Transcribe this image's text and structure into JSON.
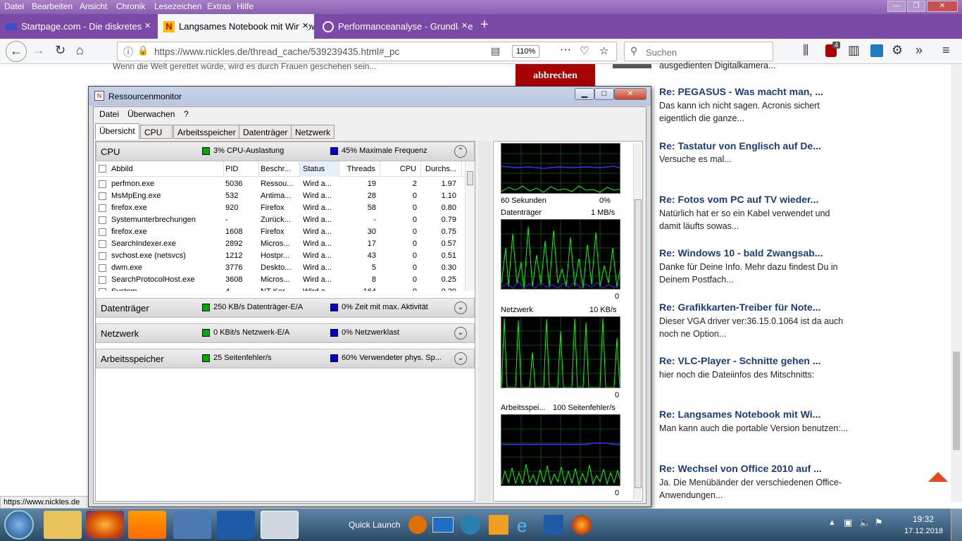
{
  "menu": [
    "Datei",
    "Bearbeiten",
    "Ansicht",
    "Chronik",
    "Lesezeichen",
    "Extras",
    "Hilfe"
  ],
  "window_controls": {
    "minimize": "—",
    "restore": "❐",
    "close": "✕"
  },
  "tabs": [
    {
      "title": "Startpage.com - Die diskreteste",
      "close": "×"
    },
    {
      "title": "Langsames Notebook mit Windows",
      "close": "×"
    },
    {
      "title": "Performanceanalyse - Grundlage",
      "close": "×"
    }
  ],
  "new_tab": "+",
  "nav": {
    "url": "https://www.nickles.de/thread_cache/539239435.html#_pc",
    "zoom": "110%",
    "search_placeholder": "Suchen",
    "badge": "4"
  },
  "page": {
    "top_text": "Wenn die Welt gerettet würde, wird es durch Frauen geschehen sein...",
    "cancel_button": "abbrechen",
    "top_right_text": "ausgedienten Digitalkamera...",
    "threads": [
      {
        "title": "Re: PEGASUS - Was macht man, ...",
        "text": "Das kann ich nicht sagen. Acronis sichert eigentlich die ganze..."
      },
      {
        "title": "Re: Tastatur von Englisch auf De...",
        "text": "Versuche es mal..."
      },
      {
        "title": "Re: Fotos vom PC auf TV wieder...",
        "text": "Natürlich hat er so ein Kabel verwendet und damit läufts sowas..."
      },
      {
        "title": "Re: Windows 10 - bald Zwangsab...",
        "text": "Danke für Deine Info. Mehr dazu findest Du in Deinem Postfach..."
      },
      {
        "title": "Re: Grafikkarten-Treiber für Note...",
        "text": "Dieser VGA driver ver:36.15.0.1064 ist da auch noch ne Option..."
      },
      {
        "title": "Re: VLC-Player - Schnitte gehen ...",
        "text": "hier noch die Dateiinfos des Mitschnitts:"
      },
      {
        "title": "Re: Langsames Notebook mit Wi...",
        "text": "Man kann auch die portable Version benutzen:..."
      },
      {
        "title": "Re: Wechsel von Office 2010 auf ...",
        "text": "Ja. Die Menübänder der verschiedenen Office-Anwendungen..."
      }
    ]
  },
  "status_url": "https://www.nickles.de",
  "resmon": {
    "title": "Ressourcenmonitor",
    "menu": [
      "Datei",
      "Überwachen",
      "?"
    ],
    "tabs": [
      "Übersicht",
      "CPU",
      "Arbeitsspeicher",
      "Datenträger",
      "Netzwerk"
    ],
    "cpu": {
      "label": "CPU",
      "stat1": "3% CPU-Auslastung",
      "stat2": "45% Maximale Frequenz",
      "columns": [
        "Abbild",
        "PID",
        "Beschr...",
        "Status",
        "Threads",
        "CPU",
        "Durchs..."
      ],
      "rows": [
        [
          "perfmon.exe",
          "5036",
          "Ressou...",
          "Wird a...",
          "19",
          "2",
          "1.97"
        ],
        [
          "MsMpEng.exe",
          "532",
          "Antima...",
          "Wird a...",
          "28",
          "0",
          "1.10"
        ],
        [
          "firefox.exe",
          "920",
          "Firefox",
          "Wird a...",
          "58",
          "0",
          "0.80"
        ],
        [
          "Systemunterbrechungen",
          "-",
          "Zurück...",
          "Wird a...",
          "-",
          "0",
          "0.79"
        ],
        [
          "firefox.exe",
          "1608",
          "Firefox",
          "Wird a...",
          "30",
          "0",
          "0.75"
        ],
        [
          "SearchIndexer.exe",
          "2892",
          "Micros...",
          "Wird a...",
          "17",
          "0",
          "0.57"
        ],
        [
          "svchost.exe (netsvcs)",
          "1212",
          "Hostpr...",
          "Wird a...",
          "43",
          "0",
          "0.51"
        ],
        [
          "dwm.exe",
          "3776",
          "Deskto...",
          "Wird a...",
          "5",
          "0",
          "0.30"
        ],
        [
          "SearchProtocolHost.exe",
          "3608",
          "Micros...",
          "Wird a...",
          "8",
          "0",
          "0.25"
        ],
        [
          "System",
          "4",
          "NT Ker...",
          "Wird a...",
          "164",
          "0",
          "0.20"
        ]
      ]
    },
    "disk": {
      "label": "Datenträger",
      "stat1": "250 KB/s Datenträger-E/A",
      "stat2": "0% Zeit mit max. Aktivität"
    },
    "network": {
      "label": "Netzwerk",
      "stat1": "0 KBit/s Netzwerk-E/A",
      "stat2": "0% Netzwerklast"
    },
    "memory": {
      "label": "Arbeitsspeicher",
      "stat1": "25 Seitenfehler/s",
      "stat2": "60% Verwendeter phys. Sp..."
    },
    "graphs": [
      {
        "top_left": "",
        "top_right": "",
        "bottom_left": "60 Sekunden",
        "bottom_right": "0%"
      },
      {
        "top_left": "Datenträger",
        "top_right": "1 MB/s",
        "bottom_right": "0"
      },
      {
        "top_left": "Netzwerk",
        "top_right": "10 KB/s",
        "bottom_right": "0"
      },
      {
        "top_left": "Arbeitsspei...",
        "top_right": "100 Seitenfehler/s",
        "bottom_right": "0"
      }
    ]
  },
  "taskbar": {
    "quick_launch": "Quick Launch",
    "time": "19:32",
    "date": "17.12.2018"
  }
}
